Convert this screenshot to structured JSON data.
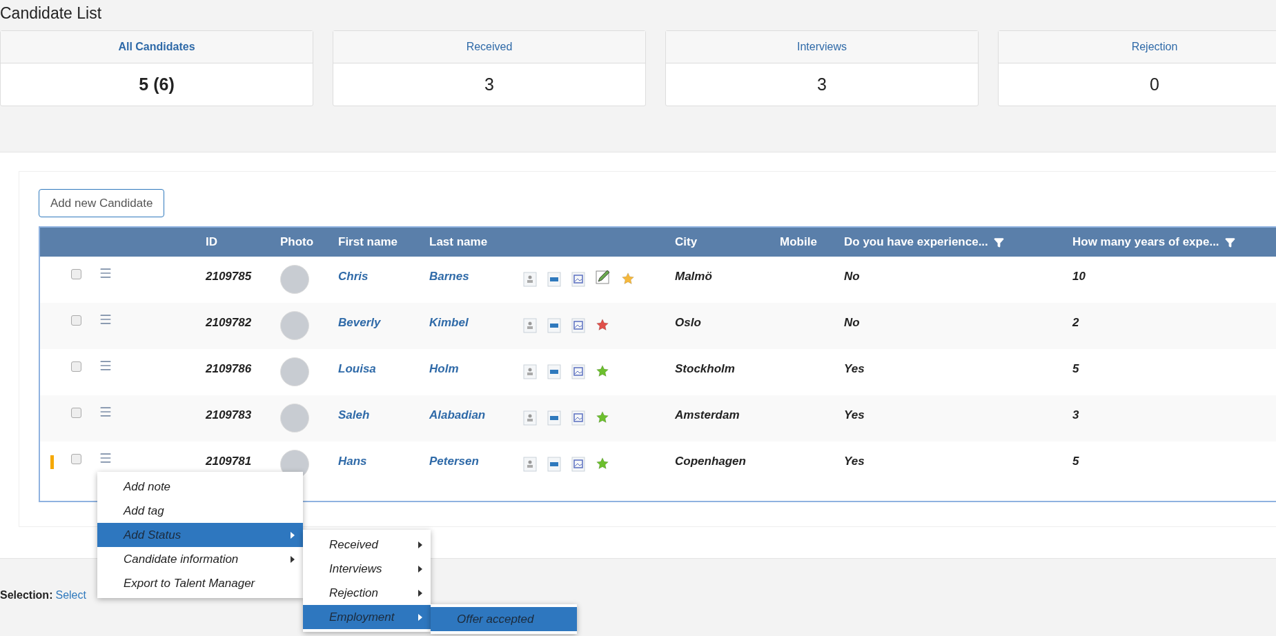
{
  "page_title": "Candidate List",
  "summary_cards": [
    {
      "label": "All Candidates",
      "value": "5 (6)",
      "selected": true
    },
    {
      "label": "Received",
      "value": "3",
      "selected": false
    },
    {
      "label": "Interviews",
      "value": "3",
      "selected": false
    },
    {
      "label": "Rejection",
      "value": "0",
      "selected": false
    }
  ],
  "add_button": "Add new Candidate",
  "table": {
    "columns": [
      "ID",
      "Photo",
      "First name",
      "Last name",
      "City",
      "Mobile",
      "Do you have experience...",
      "How many years of expe..."
    ],
    "filter_columns": [
      false,
      false,
      false,
      false,
      false,
      false,
      true,
      true
    ],
    "rows": [
      {
        "id": "2109785",
        "first_name": "Chris",
        "last_name": "Barnes",
        "city": "Malmö",
        "experience": "No",
        "years": "10",
        "checked": false,
        "edit_icon": true,
        "color": "#f5b83d",
        "marked": false
      },
      {
        "id": "2109782",
        "first_name": "Beverly",
        "last_name": "Kimbel",
        "city": "Oslo",
        "experience": "No",
        "years": "2",
        "checked": false,
        "edit_icon": false,
        "color": "#e0504a",
        "marked": false
      },
      {
        "id": "2109786",
        "first_name": "Louisa",
        "last_name": "Holm",
        "city": "Stockholm",
        "experience": "Yes",
        "years": "5",
        "checked": false,
        "edit_icon": false,
        "color": "#6cbf2e",
        "marked": false
      },
      {
        "id": "2109783",
        "first_name": "Saleh",
        "last_name": "Alabadian",
        "city": "Amsterdam",
        "experience": "Yes",
        "years": "3",
        "checked": false,
        "edit_icon": false,
        "color": "#6cbf2e",
        "marked": false
      },
      {
        "id": "2109781",
        "first_name": "Hans",
        "last_name": "Petersen",
        "city": "Copenhagen",
        "experience": "Yes",
        "years": "5",
        "checked": false,
        "edit_icon": false,
        "color": "#6cbf2e",
        "marked": true
      }
    ]
  },
  "selection": {
    "label": "Selection:",
    "link": "Select"
  },
  "context_menu": [
    {
      "label": "Add note",
      "selected": false,
      "submenu": false
    },
    {
      "label": "Add tag",
      "selected": false,
      "submenu": false
    },
    {
      "label": "Add Status",
      "selected": true,
      "submenu": true,
      "children": [
        {
          "label": "Received",
          "selected": false,
          "submenu": true
        },
        {
          "label": "Interviews",
          "selected": false,
          "submenu": true
        },
        {
          "label": "Rejection",
          "selected": false,
          "submenu": true
        },
        {
          "label": "Employment",
          "selected": true,
          "submenu": true,
          "children": [
            {
              "label": "Offer accepted",
              "selected": true,
              "submenu": false
            }
          ]
        }
      ]
    },
    {
      "label": "Candidate information",
      "selected": false,
      "submenu": true
    },
    {
      "label": "Export to Talent Manager",
      "selected": false,
      "submenu": false
    }
  ]
}
